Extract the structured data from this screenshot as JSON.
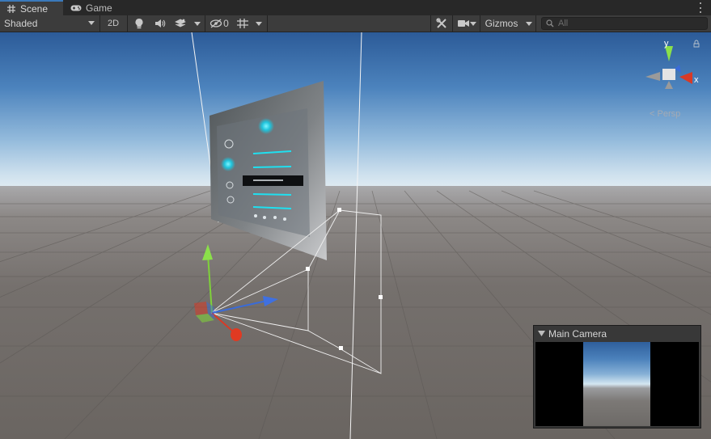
{
  "tabs": [
    {
      "label": "Scene",
      "icon": "grid-icon",
      "active": true
    },
    {
      "label": "Game",
      "icon": "gamepad-icon",
      "active": false
    }
  ],
  "toolbar": {
    "shading_mode": "Shaded",
    "mode_2d_label": "2D",
    "hidden_count": "0",
    "gizmos_label": "Gizmos",
    "search_placeholder": "All"
  },
  "orientation_gizmo": {
    "y_label": "y",
    "x_label": "x",
    "projection_label": "Persp"
  },
  "camera_preview": {
    "title": "Main Camera"
  },
  "colors": {
    "accent": "#3a79bb",
    "axis_x": "#d83a26",
    "axis_y": "#7fd13a",
    "axis_z": "#3a6bd8",
    "sky_top": "#2c5b98",
    "horizon": "#dbe8f0",
    "ground": "#6e6864"
  }
}
